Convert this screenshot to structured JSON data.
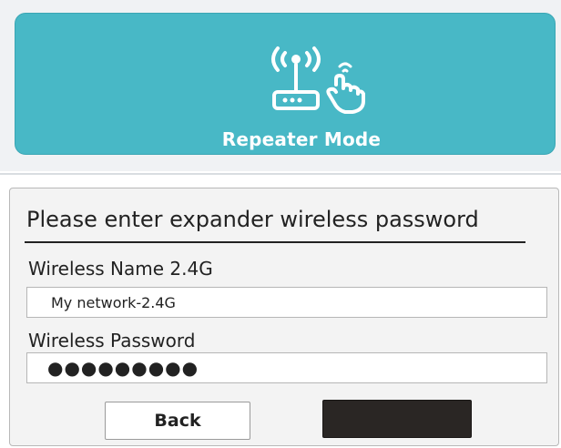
{
  "mode": {
    "title": "Repeater Mode",
    "icon": "router-tap-icon",
    "color": "#48b8c6"
  },
  "form": {
    "title": "Please enter expander wireless password",
    "name_label": "Wireless Name 2.4G",
    "name_value": "My network-2.4G",
    "password_label": "Wireless Password",
    "password_value": "●●●●●●●●●",
    "back_label": "Back",
    "next_label": ""
  }
}
